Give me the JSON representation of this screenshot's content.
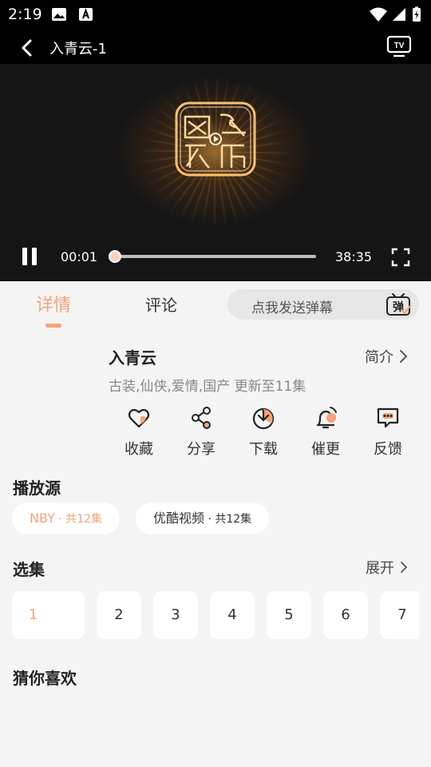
{
  "status_bar": {
    "time": "2:19"
  },
  "header": {
    "title": "入青云-1"
  },
  "player": {
    "current_time": "00:01",
    "total_time": "38:35",
    "progress": 0.0
  },
  "tabs": {
    "detail": "详情",
    "comment": "评论"
  },
  "danmu": {
    "placeholder": "点我发送弹幕",
    "icon_char": "弹"
  },
  "show": {
    "title": "入青云",
    "intro_label": "简介",
    "meta": "古装,仙侠,爱情,国产 更新至11集"
  },
  "actions": [
    {
      "label": "收藏",
      "icon": "heart-icon"
    },
    {
      "label": "分享",
      "icon": "share-icon"
    },
    {
      "label": "下载",
      "icon": "download-icon"
    },
    {
      "label": "催更",
      "icon": "bell-icon"
    },
    {
      "label": "反馈",
      "icon": "feedback-icon"
    }
  ],
  "sources": {
    "heading": "播放源",
    "items": [
      {
        "name": "NBY",
        "count": " · 共12集",
        "selected": true
      },
      {
        "name": "优酷视频",
        "count": " · 共12集",
        "selected": false
      }
    ]
  },
  "episodes": {
    "heading": "选集",
    "expand_label": "展开",
    "items": [
      "1",
      "2",
      "3",
      "4",
      "5",
      "6",
      "7"
    ],
    "active": "1"
  },
  "recommend": {
    "heading": "猜你喜欢"
  },
  "colors": {
    "accent": "#f7a27a",
    "background": "#f4f4f4"
  }
}
